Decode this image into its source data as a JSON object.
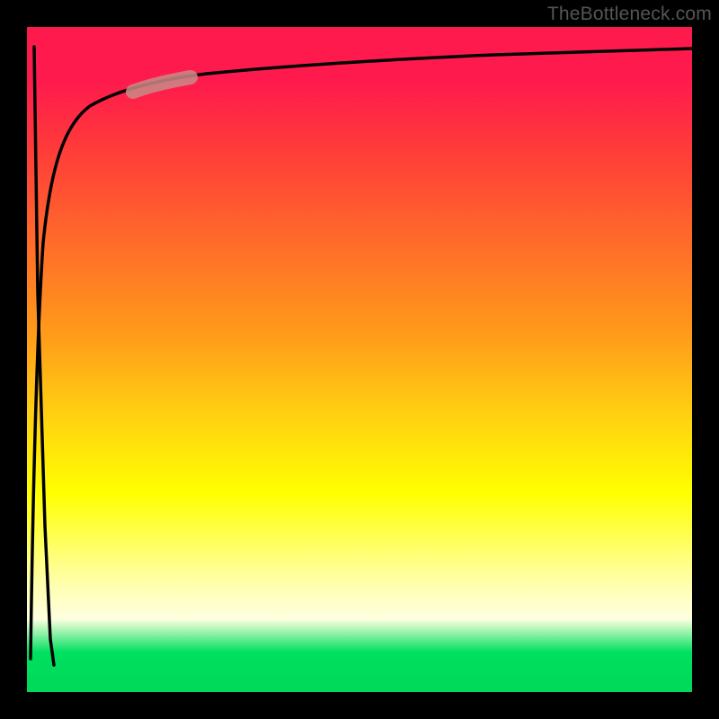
{
  "watermark": "TheBottleneck.com",
  "chart_data": {
    "type": "line",
    "title": "",
    "xlabel": "",
    "ylabel": "",
    "xlim": [
      0,
      100
    ],
    "ylim": [
      0,
      100
    ],
    "grid": false,
    "legend": false,
    "annotations": [
      {
        "type": "highlight-segment",
        "x_range": [
          14,
          22
        ],
        "note": "highlighted portion of curve"
      }
    ],
    "series": [
      {
        "name": "bottleneck-curve",
        "x": [
          0.5,
          1,
          1.5,
          2,
          3,
          4,
          5,
          6,
          8,
          10,
          14,
          18,
          22,
          30,
          40,
          55,
          70,
          85,
          100
        ],
        "y": [
          5,
          20,
          40,
          56,
          70,
          76,
          80,
          82.5,
          85,
          86.5,
          88,
          89,
          89.6,
          90.8,
          91.8,
          92.8,
          93.5,
          94,
          94.5
        ]
      },
      {
        "name": "left-spike",
        "x": [
          0.5,
          1,
          2,
          3,
          3.5
        ],
        "y": [
          97,
          60,
          25,
          8,
          4
        ]
      }
    ],
    "colors": {
      "curve": "#000000",
      "highlight": "#c98a86"
    }
  }
}
